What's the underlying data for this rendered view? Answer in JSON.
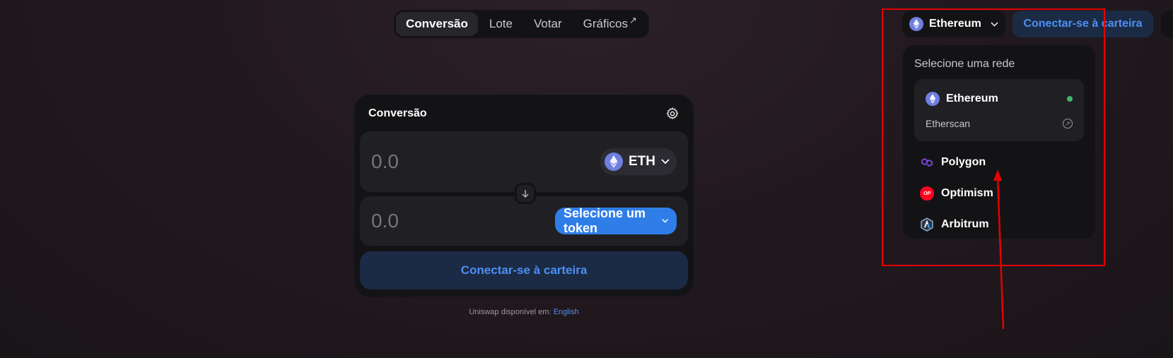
{
  "nav": {
    "items": [
      {
        "label": "Conversão",
        "active": true
      },
      {
        "label": "Lote",
        "active": false
      },
      {
        "label": "Votar",
        "active": false
      },
      {
        "label": "Gráficos",
        "active": false,
        "external_glyph": "↗"
      }
    ]
  },
  "header": {
    "network_label": "Ethereum",
    "connect_label": "Conectar-se à carteira"
  },
  "network_dropdown": {
    "title": "Selecione uma rede",
    "selected": {
      "label": "Ethereum",
      "explorer_label": "Etherscan",
      "status_color": "#40b66b"
    },
    "options": [
      {
        "label": "Polygon",
        "icon": "polygon-icon"
      },
      {
        "label": "Optimism",
        "icon": "optimism-icon",
        "icon_text": "OP"
      },
      {
        "label": "Arbitrum",
        "icon": "arbitrum-icon"
      }
    ]
  },
  "swap": {
    "title": "Conversão",
    "input_amount_placeholder": "0.0",
    "input_token": "ETH",
    "output_amount_placeholder": "0.0",
    "output_token_button": "Selecione um token",
    "connect_label": "Conectar-se à carteira"
  },
  "footer": {
    "text": "Uniswap disponível em:",
    "link": "English"
  },
  "colors": {
    "accent": "#4c8ff5",
    "primary_button": "#2f7ee8",
    "annotation": "#e60000"
  }
}
